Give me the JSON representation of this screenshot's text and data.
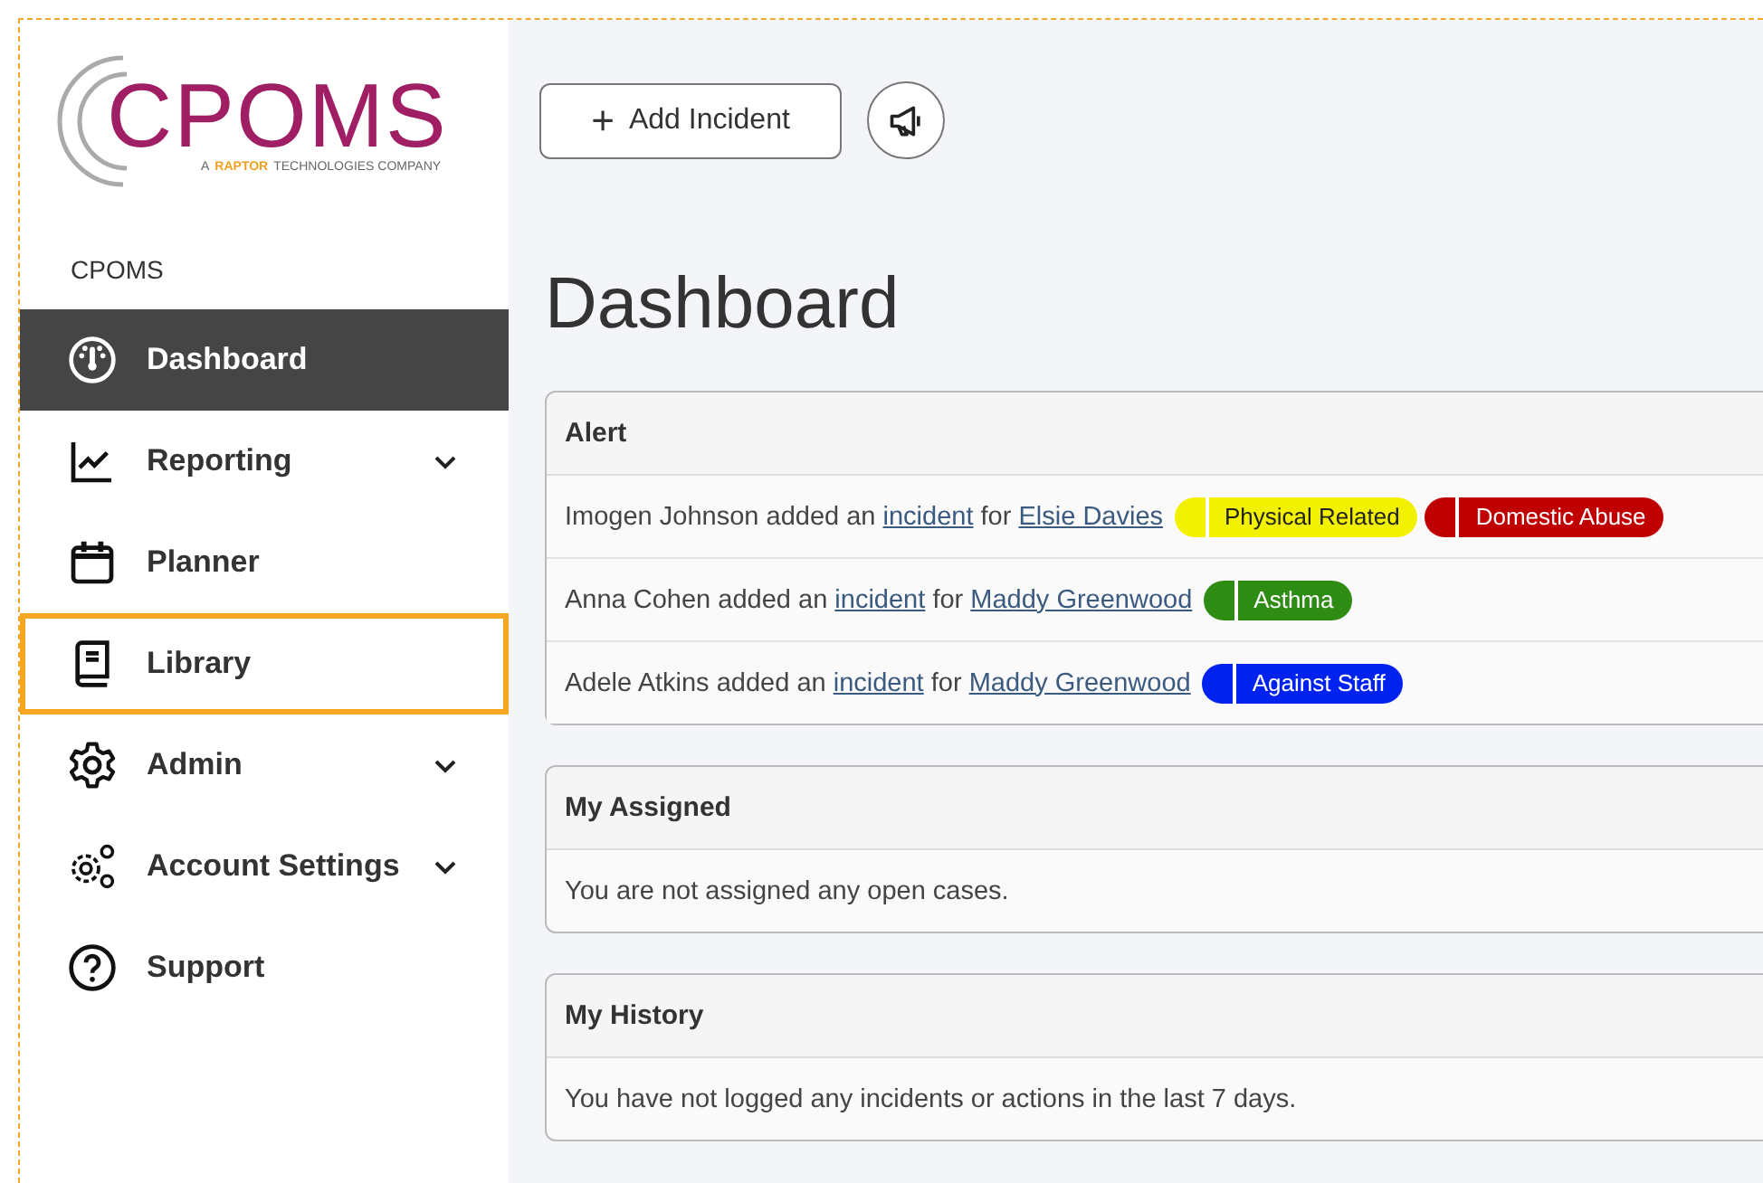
{
  "logo": {
    "wordmark": "CPOMS",
    "tagline_prefix": "A",
    "tagline_brand": "RAPTOR",
    "tagline_suffix": "TECHNOLOGIES COMPANY"
  },
  "sidebar": {
    "heading": "CPOMS",
    "items": [
      {
        "label": "Dashboard",
        "selected": true,
        "highlighted": false,
        "expandable": false
      },
      {
        "label": "Reporting",
        "selected": false,
        "highlighted": false,
        "expandable": true
      },
      {
        "label": "Planner",
        "selected": false,
        "highlighted": false,
        "expandable": false
      },
      {
        "label": "Library",
        "selected": false,
        "highlighted": true,
        "expandable": false
      },
      {
        "label": "Admin",
        "selected": false,
        "highlighted": false,
        "expandable": true
      },
      {
        "label": "Account Settings",
        "selected": false,
        "highlighted": false,
        "expandable": true
      },
      {
        "label": "Support",
        "selected": false,
        "highlighted": false,
        "expandable": false
      }
    ]
  },
  "toolbar": {
    "add_button": {
      "icon": "+",
      "label": "Add Incident"
    }
  },
  "page_title": "Dashboard",
  "alert": {
    "title": "Alert",
    "rows": [
      {
        "actor": "Imogen Johnson",
        "verb": "added an",
        "link": "incident",
        "preposition": "for",
        "student": "Elsie Davies",
        "tags": [
          {
            "label": "Physical Related",
            "color": "#f2f200"
          },
          {
            "label": "Domestic Abuse",
            "color": "#c00000"
          }
        ]
      },
      {
        "actor": "Anna Cohen",
        "verb": "added an",
        "link": "incident",
        "preposition": "for",
        "student": "Maddy Greenwood",
        "tags": [
          {
            "label": "Asthma",
            "color": "#2e8b14"
          }
        ]
      },
      {
        "actor": "Adele Atkins",
        "verb": "added an",
        "link": "incident",
        "preposition": "for",
        "student": "Maddy Greenwood",
        "tags": [
          {
            "label": "Against Staff",
            "color": "#0022ee"
          }
        ]
      }
    ]
  },
  "assigned": {
    "title": "My Assigned",
    "message": "You are not assigned any open cases."
  },
  "history": {
    "title": "My History",
    "message": "You have not logged any incidents or actions in the last 7 days."
  }
}
